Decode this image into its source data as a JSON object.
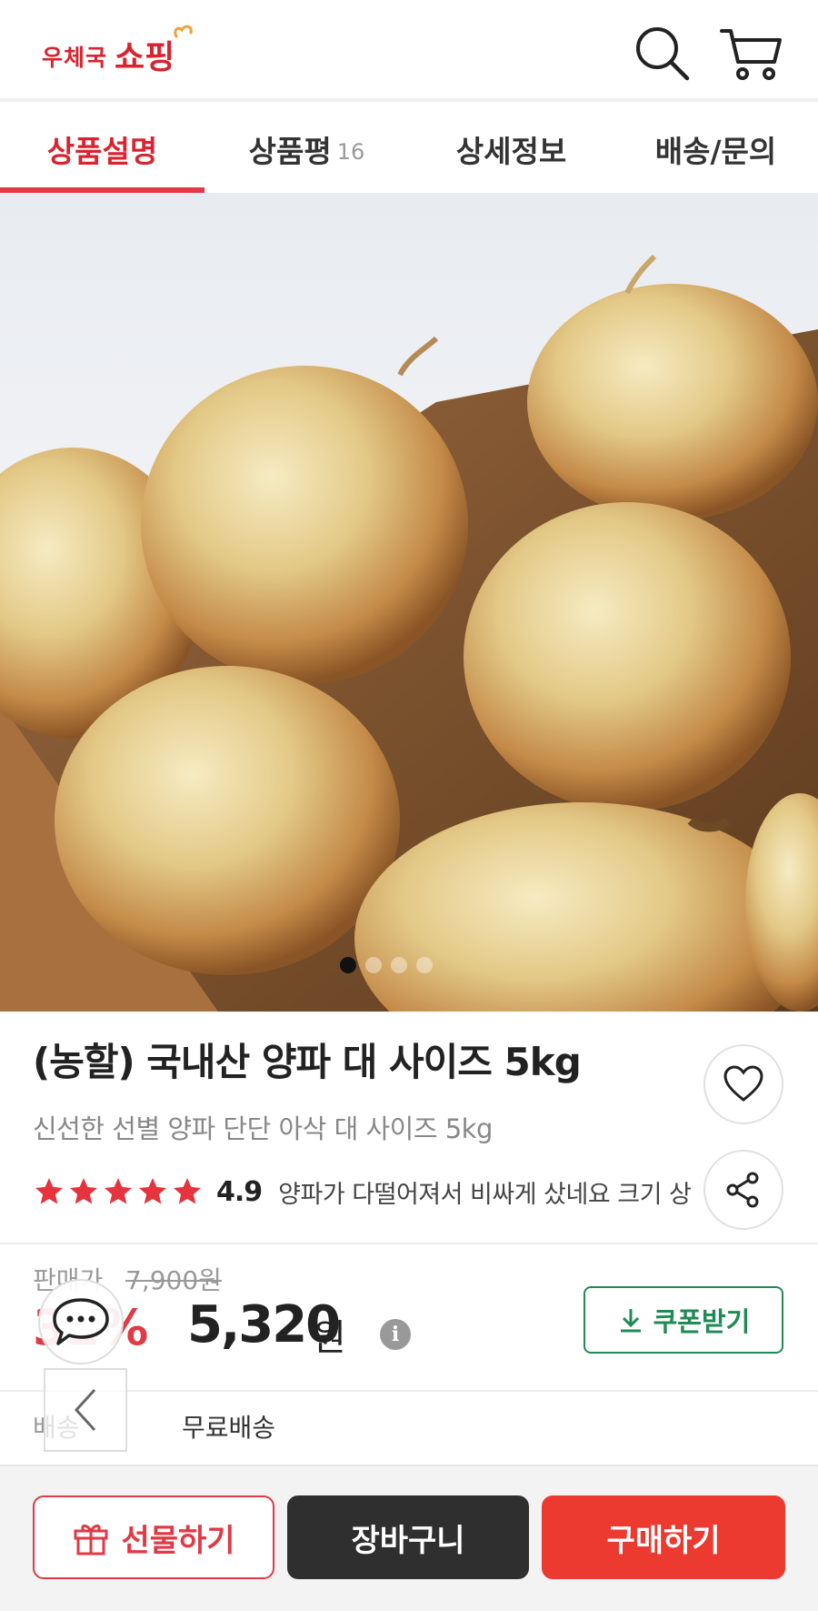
{
  "header": {
    "logo_small": "우체국",
    "logo_big": "쇼핑",
    "search_icon": "search-icon",
    "cart_icon": "cart-icon"
  },
  "tabs": [
    {
      "label": "상품설명",
      "active": true
    },
    {
      "label": "상품평",
      "count": "16"
    },
    {
      "label": "상세정보"
    },
    {
      "label": "배송/문의"
    }
  ],
  "product": {
    "title": "(농할) 국내산 양파 대 사이즈 5kg",
    "subtitle": "신선한 선별 양파 단단 아삭 대 사이즈 5kg",
    "rating": "4.9",
    "rating_stars": 5,
    "review_snippet": "양파가 다떨어져서 비싸게 샀네요 크기 상태",
    "image_dots": 4,
    "active_dot": 0
  },
  "price": {
    "label": "판매가",
    "original": "7,900원",
    "discount": "32%",
    "sale": "5,320",
    "unit": "원",
    "info_icon": "i",
    "coupon_label": "쿠폰받기"
  },
  "shipping": {
    "label": "배송",
    "value": "무료배송"
  },
  "bottom": {
    "gift_label": "선물하기",
    "cart_label": "장바구니",
    "buy_label": "구매하기"
  },
  "colors": {
    "brand_red": "#d9232e",
    "buy_red": "#ec3a30",
    "cart_dark": "#2f2f2f",
    "coupon_green": "#1f8a54"
  }
}
